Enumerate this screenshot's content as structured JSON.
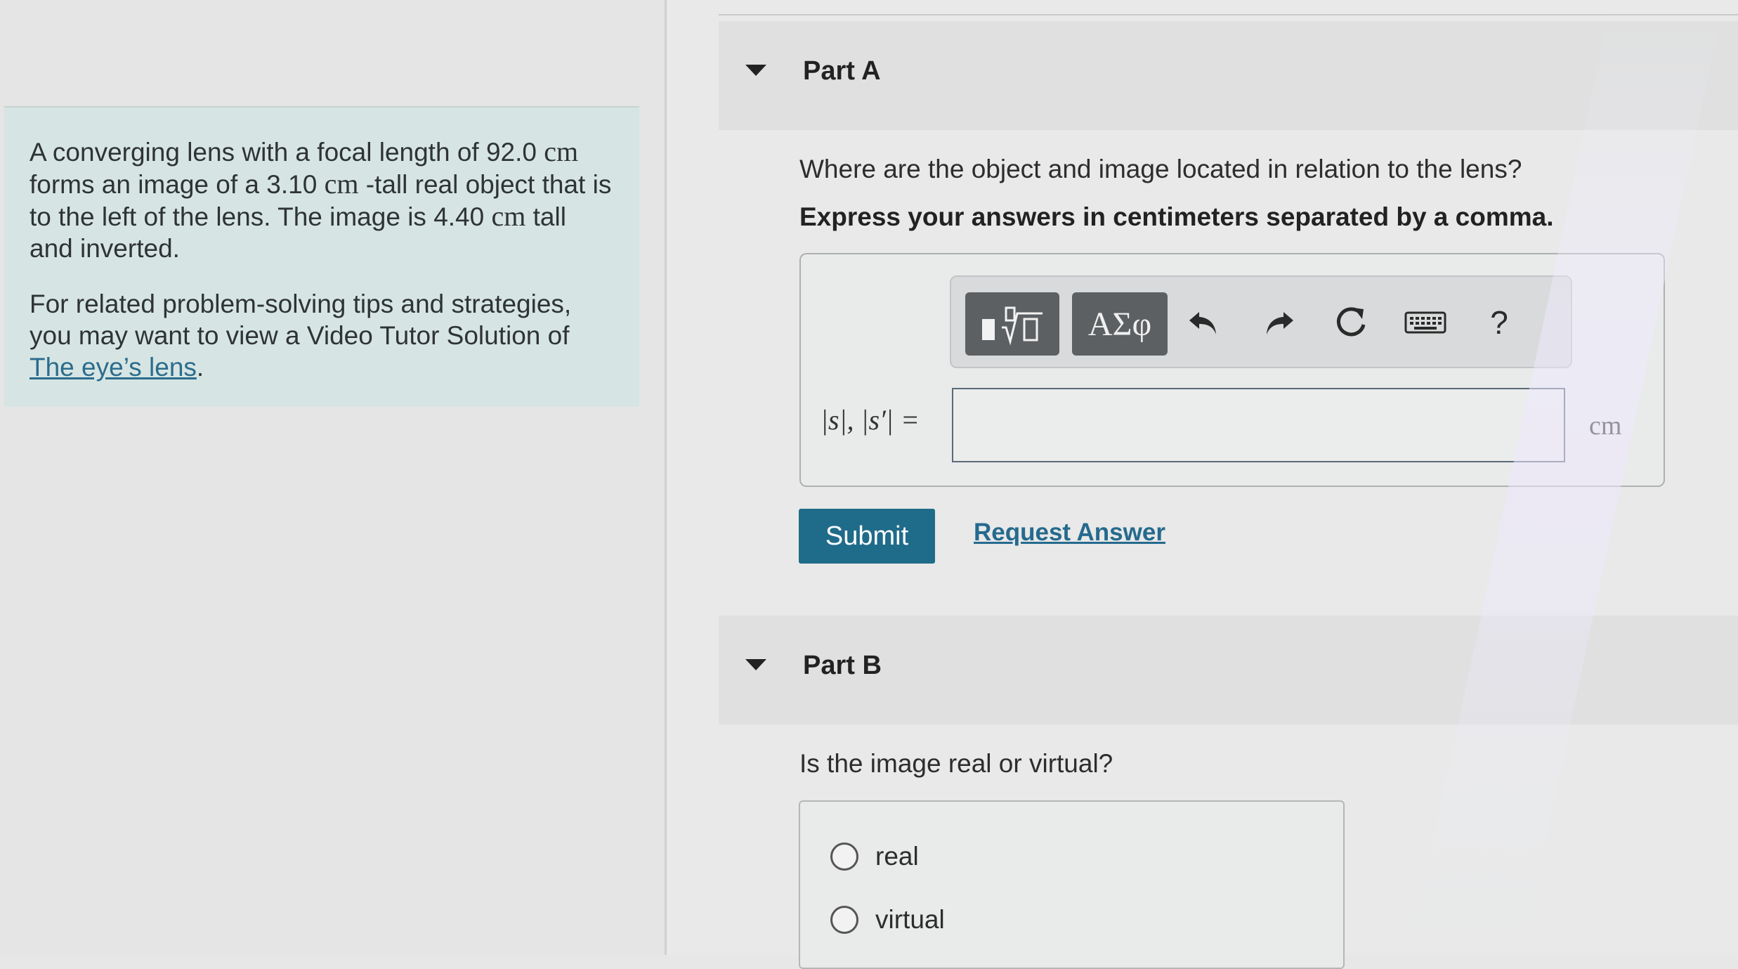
{
  "problem": {
    "statement_parts": [
      "A converging lens with a focal length of 92.0 ",
      "cm",
      " forms an image of a 3.10 ",
      "cm",
      " -tall real object that is to the left of the lens. The image is 4.40 ",
      "cm",
      " tall and inverted."
    ],
    "tips_text": "For related problem-solving tips and strategies, you may want to view a Video Tutor Solution of",
    "tips_link": "The eye’s lens",
    "tips_period": "."
  },
  "part_a": {
    "title": "Part A",
    "question": "Where are the object and image located in relation to the lens?",
    "instruction": "Express your answers in centimeters separated by a comma.",
    "toolbar": {
      "templates_icon": "templates-icon",
      "symbols_label": "AΣφ",
      "undo_icon": "undo-icon",
      "redo_icon": "redo-icon",
      "reset_icon": "reset-icon",
      "keyboard_icon": "keyboard-icon",
      "help_label": "?"
    },
    "variable_label": "|s|, |s′| =",
    "answer_value": "",
    "unit": "cm",
    "submit_label": "Submit",
    "request_answer_label": "Request Answer"
  },
  "part_b": {
    "title": "Part B",
    "question": "Is the image real or virtual?",
    "options": [
      "real",
      "virtual"
    ]
  },
  "colors": {
    "accent": "#1f6b8a",
    "link": "#266a8e",
    "info_bg": "#d6e5e3"
  }
}
